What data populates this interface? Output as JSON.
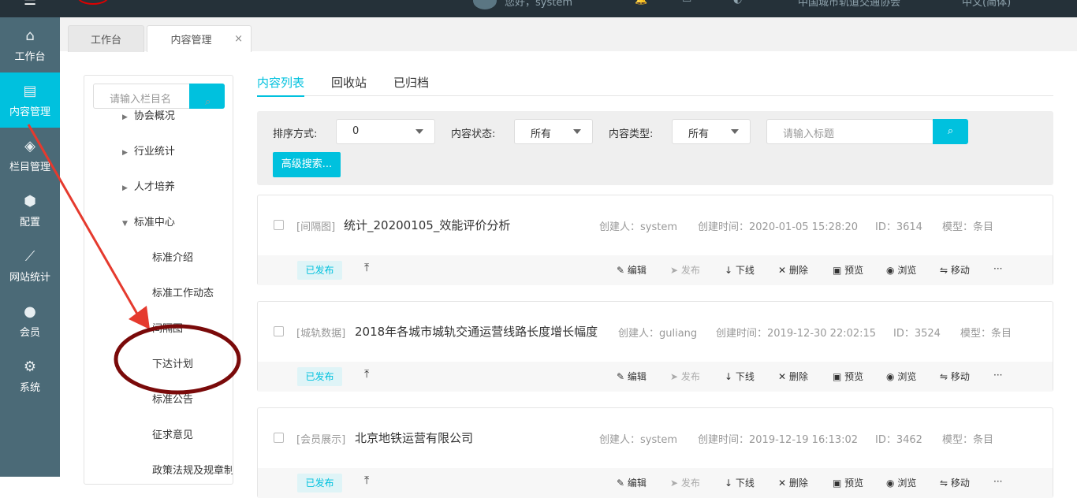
{
  "topbar": {
    "greeting": "您好，system",
    "org": "中国城市轨道交通协会",
    "lang": "中文(简体)"
  },
  "sidebar": [
    {
      "label": "工作台",
      "icon": "home-icon"
    },
    {
      "label": "内容管理",
      "icon": "document-icon"
    },
    {
      "label": "栏目管理",
      "icon": "layers-icon"
    },
    {
      "label": "配置",
      "icon": "cube-icon"
    },
    {
      "label": "网站统计",
      "icon": "chart-icon"
    },
    {
      "label": "会员",
      "icon": "user-icon"
    },
    {
      "label": "系统",
      "icon": "gear-icon"
    }
  ],
  "tabs": [
    {
      "label": "工作台"
    },
    {
      "label": "内容管理",
      "close": "×"
    }
  ],
  "tree": {
    "placeholder": "请输入栏目名",
    "nodes": [
      "协会概况",
      "行业统计",
      "人才培养",
      "标准中心",
      "标准介绍",
      "标准工作动态",
      "间隔图",
      "下达计划",
      "标准公告",
      "征求意见",
      "政策法规及规章制度"
    ]
  },
  "content_tabs": [
    "内容列表",
    "回收站",
    "已归档"
  ],
  "filter": {
    "sort_label": "排序方式:",
    "sort_value": "0",
    "status_label": "内容状态:",
    "status_value": "所有",
    "type_label": "内容类型:",
    "type_value": "所有",
    "title_placeholder": "请输入标题",
    "advanced": "高级搜索..."
  },
  "actions": {
    "edit": "编辑",
    "publish": "发布",
    "offline": "下线",
    "delete": "删除",
    "preview": "预览",
    "browse": "浏览",
    "move": "移动",
    "more": "···"
  },
  "items": [
    {
      "category": "[间隔图]",
      "title": "统计_20200105_效能评价分析",
      "creator": "创建人：system",
      "time": "创建时间：2020-01-05 15:28:20",
      "id": "ID：3614",
      "model": "模型：条目",
      "status": "已发布"
    },
    {
      "category": "[城轨数据]",
      "title": "2018年各城市城轨交通运营线路长度增长幅度",
      "creator": "创建人：guliang",
      "time": "创建时间：2019-12-30 22:02:15",
      "id": "ID：3524",
      "model": "模型：条目",
      "status": "已发布"
    },
    {
      "category": "[会员展示]",
      "title": "北京地铁运营有限公司",
      "creator": "创建人：system",
      "time": "创建时间：2019-12-19 16:13:02",
      "id": "ID：3462",
      "model": "模型：条目",
      "status": "已发布"
    }
  ]
}
